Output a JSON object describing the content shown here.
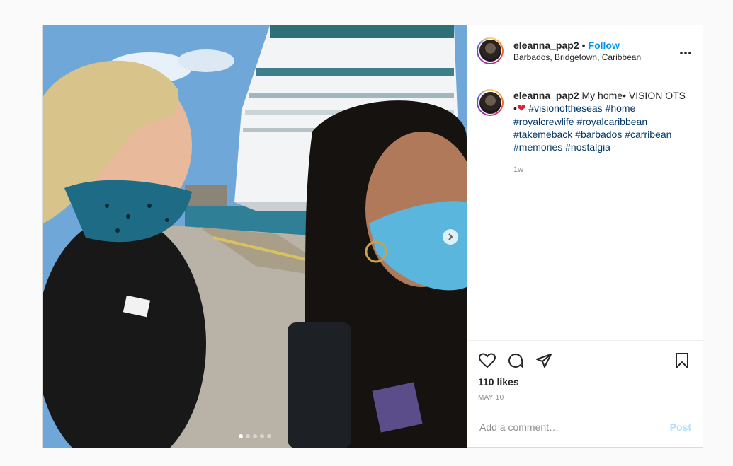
{
  "header": {
    "username": "eleanna_pap2",
    "bullet": "•",
    "follow_label": "Follow",
    "location": "Barbados, Bridgetown, Caribbean",
    "more_icon": "more-horizontal-icon"
  },
  "caption": {
    "username": "eleanna_pap2",
    "text_start": "My home• VISION OTS",
    "bullet": "•",
    "heart": "❤",
    "hashtags": [
      "#visionoftheseas",
      "#home",
      "#royalcrewlife",
      "#royalcaribbean",
      "#takemeback",
      "#barbados",
      "#carribean",
      "#memories",
      "#nostalgia"
    ],
    "time": "1w"
  },
  "actions": {
    "like_icon": "heart-icon",
    "comment_icon": "comment-icon",
    "share_icon": "share-icon",
    "save_icon": "bookmark-icon"
  },
  "likes": "110 likes",
  "date": "MAY 10",
  "comment": {
    "placeholder": "Add a comment…",
    "post_label": "Post"
  },
  "carousel": {
    "slide_count": 5,
    "active_index": 0,
    "next_icon": "chevron-right-icon"
  },
  "colors": {
    "follow": "#0095f6",
    "hashtag": "#00376b",
    "post_disabled": "#b2dffc",
    "muted": "#8e8e8e"
  }
}
